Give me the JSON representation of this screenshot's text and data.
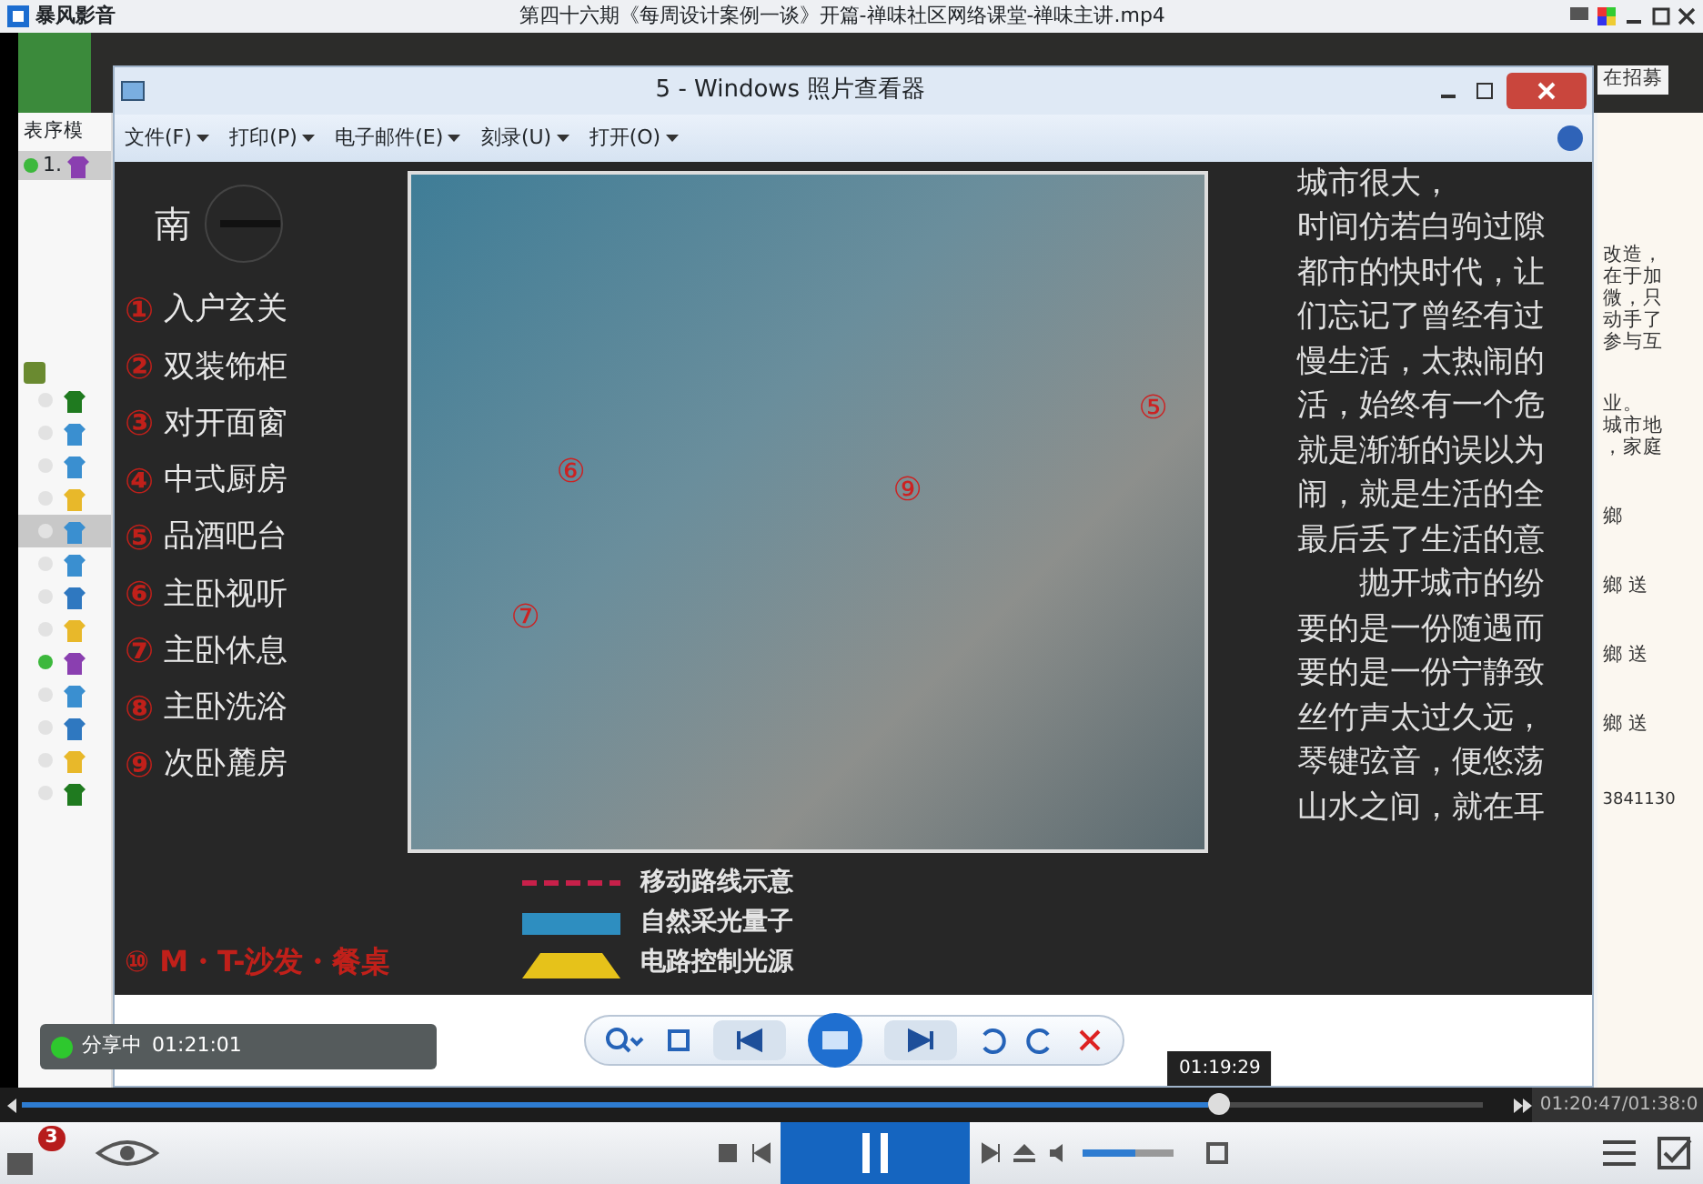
{
  "player": {
    "app_name": "暴风影音",
    "title": "第四十六期《每周设计案例一谈》开篇-禅味社区网络课堂-禅味主讲.mp4",
    "badge": "3"
  },
  "recording": {
    "left_label": "表序模",
    "right_label": "在招募",
    "top_user": {
      "number": "1.",
      "color": "#8a3fb0",
      "online": true
    },
    "users": [
      {
        "color": "#1f7a1f",
        "online": false,
        "selected": false
      },
      {
        "color": "#3a8fd0",
        "online": false,
        "selected": false
      },
      {
        "color": "#3a8fd0",
        "online": false,
        "selected": false
      },
      {
        "color": "#e8b82a",
        "online": false,
        "selected": false
      },
      {
        "color": "#3a8fd0",
        "online": false,
        "selected": true
      },
      {
        "color": "#3a8fd0",
        "online": false,
        "selected": false
      },
      {
        "color": "#2f78c0",
        "online": false,
        "selected": false
      },
      {
        "color": "#e8b82a",
        "online": false,
        "selected": false
      },
      {
        "color": "#8a3fb0",
        "online": true,
        "selected": false
      },
      {
        "color": "#3a8fd0",
        "online": false,
        "selected": false
      },
      {
        "color": "#2f78c0",
        "online": false,
        "selected": false
      },
      {
        "color": "#e8b82a",
        "online": false,
        "selected": false
      },
      {
        "color": "#1f7a1f",
        "online": false,
        "selected": false
      }
    ],
    "side_fragments": [
      "改造，",
      "在于加",
      "微，只",
      "动手了",
      "参与互",
      "业。",
      "城市地",
      "，家庭"
    ],
    "side_chat": [
      "鄉",
      "鄉 送",
      "鄉 送",
      "鄉 送"
    ],
    "side_number": "3841130",
    "share": {
      "label": "分享中",
      "time": "01:21:01"
    },
    "viewer": {
      "title": "5 - Windows 照片查看器",
      "menus": [
        "文件(F)",
        "打印(P)",
        "电子邮件(E)",
        "刻录(U)",
        "打开(O)"
      ],
      "image": {
        "compass_label": "南",
        "legend": [
          {
            "number": "①",
            "text": "入户玄关"
          },
          {
            "number": "②",
            "text": "双装饰柜"
          },
          {
            "number": "③",
            "text": "对开面窗"
          },
          {
            "number": "④",
            "text": "中式厨房"
          },
          {
            "number": "⑤",
            "text": "品酒吧台"
          },
          {
            "number": "⑥",
            "text": "主卧视听"
          },
          {
            "number": "⑦",
            "text": "主卧休息"
          },
          {
            "number": "⑧",
            "text": "主卧洗浴"
          },
          {
            "number": "⑨",
            "text": "次卧麓房"
          }
        ],
        "footer": "⑩ M・T-沙发・餐桌",
        "plan_markers": [
          "⑥",
          "⑦",
          "⑨",
          "⑤"
        ],
        "key": [
          {
            "kind": "dashed",
            "text": "移动路线示意"
          },
          {
            "kind": "band",
            "text": "自然采光量子"
          },
          {
            "kind": "lamp",
            "text": "电路控制光源"
          }
        ],
        "paragraph": [
          "城市很大，",
          "时间仿若白驹过隙",
          "都市的快时代，让",
          "们忘记了曾经有过",
          "慢生活，太热闹的",
          "活，始终有一个危",
          "就是渐渐的误以为",
          "闹，就是生活的全",
          "最后丢了生活的意",
          "　　抛开城市的纷",
          "要的是一份随遇而",
          "要的是一份宁静致",
          "丝竹声太过久远，",
          "琴键弦音，便悠荡",
          "山水之间，就在耳"
        ]
      }
    }
  },
  "seek": {
    "level": 0.82,
    "tooltip": "01:19:29",
    "time": "01:20:47/01:38:0"
  },
  "volume": {
    "level": 0.58
  }
}
